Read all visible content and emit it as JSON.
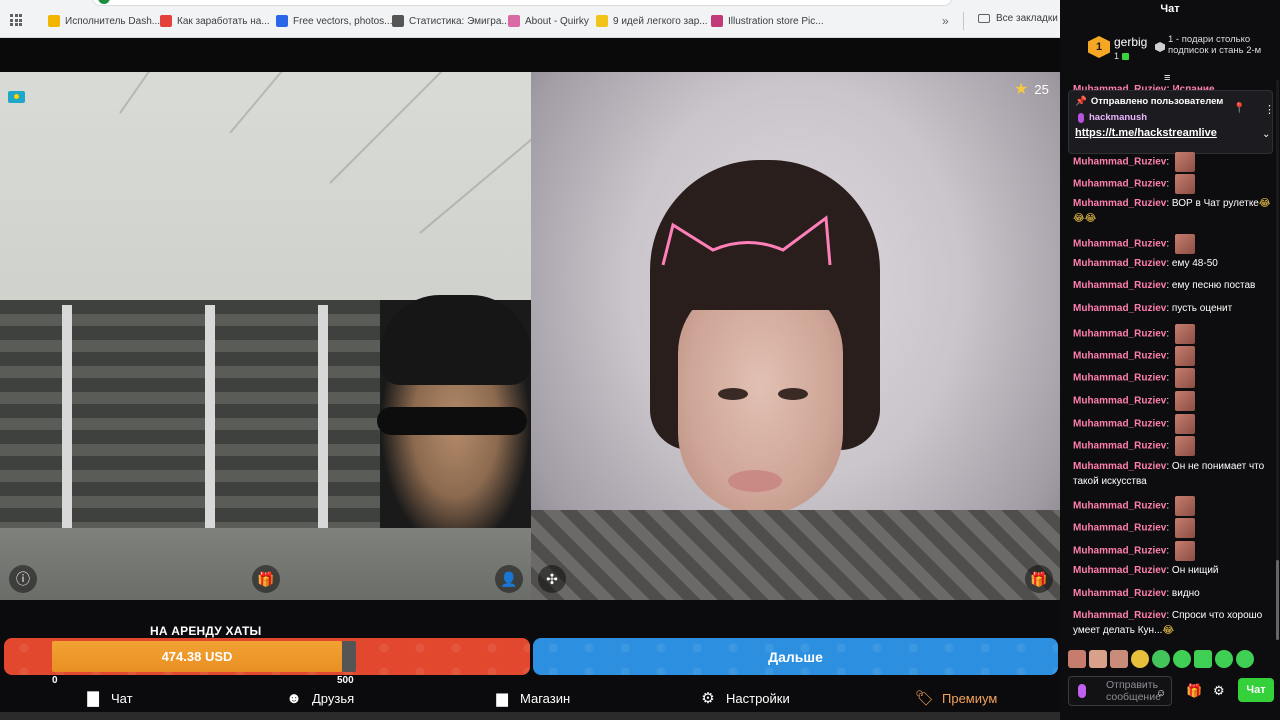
{
  "bookmarks": [
    {
      "label": "Исполнитель Dash...",
      "color": "#f3b400"
    },
    {
      "label": "Как заработать на...",
      "color": "#e4413a"
    },
    {
      "label": "Free vectors, photos...",
      "color": "#2c66e8"
    },
    {
      "label": "Статистика: Эмигра...",
      "color": "#555555"
    },
    {
      "label": "About - Quirky",
      "color": "#d96aa6"
    },
    {
      "label": "9 идей легкого зар...",
      "color": "#f2c318"
    },
    {
      "label": "Illustration store Pic...",
      "color": "#c03a7a"
    }
  ],
  "bookmarks_more": "»",
  "bookmarks_all": "Все закладки",
  "stream": {
    "star_count": "25"
  },
  "goal": {
    "title": "НА АРЕНДУ ХАТЫ",
    "amount": "474.38 USD",
    "progress": 0.9488,
    "min_label": "0",
    "max_label": "500"
  },
  "next_button": "Дальше",
  "nav": {
    "chat": "Чат",
    "friends": "Друзья",
    "shop": "Магазин",
    "settings": "Настройки",
    "premium": "Премиум"
  },
  "chat": {
    "title": "Чат",
    "top_rank": "1",
    "top_user": "gerbig",
    "top_count": "1",
    "top_hint": "1 - подари столько подписок и стань 2-м",
    "top_message_user": "Muhammad_Ruziev: Испание",
    "pinned": {
      "header": "Отправлено пользователем",
      "user": "hackmanush",
      "link": "https://t.me/hackstreamlive"
    },
    "messages": [
      {
        "user": "Muhammad_Ruziev",
        "text": "",
        "image": true
      },
      {
        "user": "Muhammad_Ruziev",
        "text": "",
        "image": true
      },
      {
        "user": "Muhammad_Ruziev",
        "text": "ВОР в Чат рулетке",
        "emoji": "😂😂😂"
      },
      {
        "user": "Muhammad_Ruziev",
        "text": "",
        "image": true
      },
      {
        "user": "Muhammad_Ruziev",
        "text": "ему 48-50"
      },
      {
        "user": "Muhammad_Ruziev",
        "text": "ему песню постав"
      },
      {
        "user": "Muhammad_Ruziev",
        "text": "пусть оценит"
      },
      {
        "user": "Muhammad_Ruziev",
        "text": "",
        "image": true
      },
      {
        "user": "Muhammad_Ruziev",
        "text": "",
        "image": true
      },
      {
        "user": "Muhammad_Ruziev",
        "text": "",
        "image": true
      },
      {
        "user": "Muhammad_Ruziev",
        "text": "",
        "image": true
      },
      {
        "user": "Muhammad_Ruziev",
        "text": "",
        "image": true
      },
      {
        "user": "Muhammad_Ruziev",
        "text": "",
        "image": true
      },
      {
        "user": "Muhammad_Ruziev",
        "text": "Он не понимает что такой искусства"
      },
      {
        "user": "Muhammad_Ruziev",
        "text": "",
        "image": true
      },
      {
        "user": "Muhammad_Ruziev",
        "text": "",
        "image": true
      },
      {
        "user": "Muhammad_Ruziev",
        "text": "",
        "image": true
      },
      {
        "user": "Muhammad_Ruziev",
        "text": "Он нищий"
      },
      {
        "user": "Muhammad_Ruziev",
        "text": "видно"
      },
      {
        "user": "Muhammad_Ruziev",
        "text": "Спроси что хорошо умеет делать Кун...",
        "emoji": "😂"
      }
    ],
    "input_placeholder": "Отправить сообщение",
    "send_button": "Чат"
  }
}
